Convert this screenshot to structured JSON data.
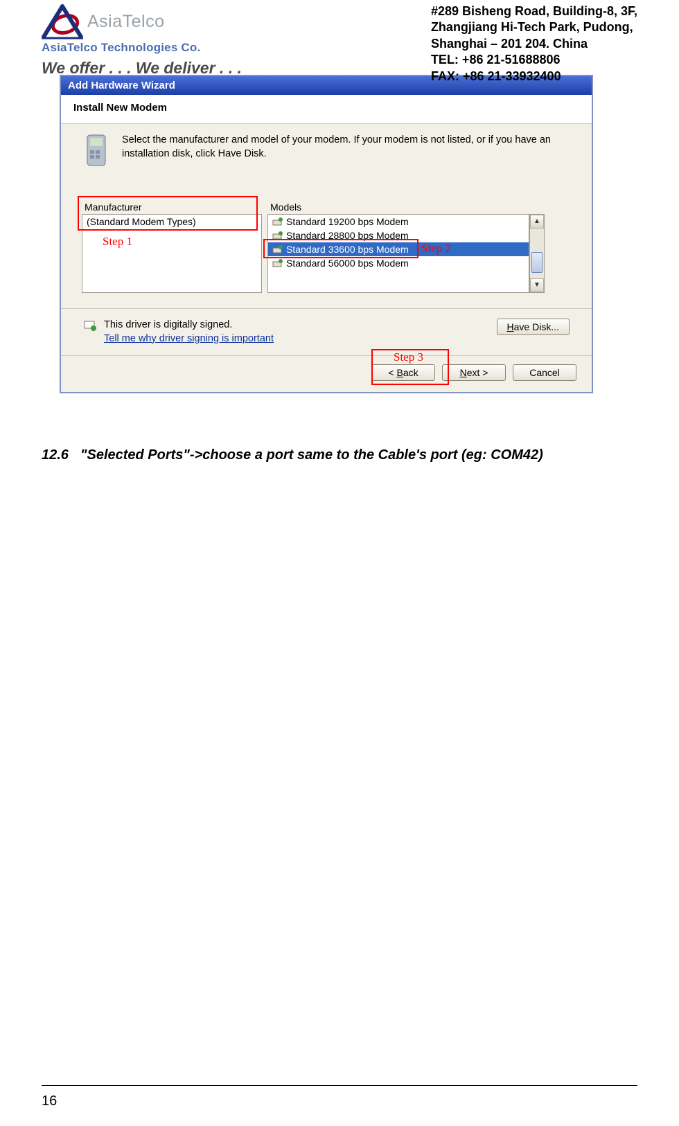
{
  "header": {
    "logo_name": "AsiaTelco",
    "logo_sub": "AsiaTelco Technologies Co.",
    "tagline": "We offer . . . We deliver . . .",
    "address_l1": "#289 Bisheng Road, Building-8, 3F,",
    "address_l2": "Zhangjiang Hi-Tech Park, Pudong,",
    "address_l3": "Shanghai – 201 204. China",
    "address_l4": "TEL: +86 21-51688806",
    "address_l5": "FAX: +86 21-33932400"
  },
  "wizard": {
    "title": "Add Hardware Wizard",
    "heading": "Install New Modem",
    "instruction": "Select the manufacturer and model of your modem. If your modem is not listed, or if you have an installation disk, click Have Disk.",
    "manufacturer_col": "Manufacturer",
    "manufacturer_items": [
      "(Standard Modem Types)"
    ],
    "models_col": "Models",
    "models_items": [
      "Standard 19200 bps Modem",
      "Standard 28800 bps Modem",
      "Standard 33600 bps Modem",
      "Standard 56000 bps Modem"
    ],
    "models_selected_index": 2,
    "signed_text": "This driver is digitally signed.",
    "signed_link": "Tell me why driver signing is important",
    "btn_back": "< Back",
    "btn_next": "Next >",
    "btn_cancel": "Cancel",
    "btn_havedisk": "Have Disk...",
    "step1_label": "Step 1",
    "step2_label": "Step 2",
    "step3_label": "Step 3"
  },
  "section": {
    "num": "12.6",
    "text": "\"Selected Ports\"->choose a port same to the Cable's port (eg: COM42)"
  },
  "page_number": "16"
}
